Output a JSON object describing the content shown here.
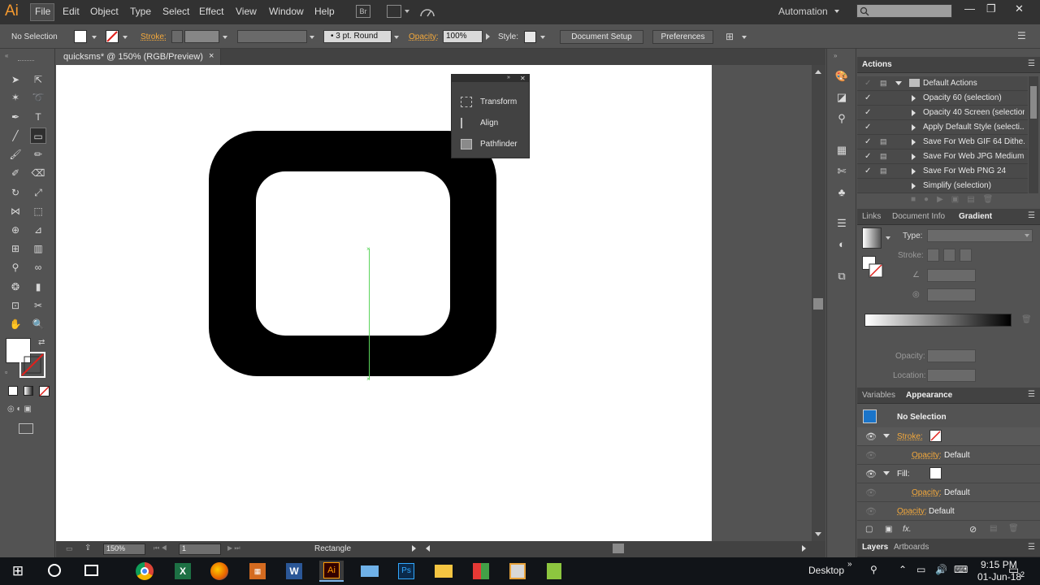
{
  "app": {
    "logo": "Ai"
  },
  "menu": [
    "File",
    "Edit",
    "Object",
    "Type",
    "Select",
    "Effect",
    "View",
    "Window",
    "Help"
  ],
  "menu_icons": {
    "bridge": "Br",
    "arrange": "arrange-documents-icon",
    "gpu": "gpu-performance-icon"
  },
  "workspace": "Automation",
  "window_buttons": {
    "minimize": "—",
    "restore": "❐",
    "close": "✕"
  },
  "control": {
    "selection": "No Selection",
    "stroke_label": "Stroke:",
    "brush": "3 pt. Round",
    "opacity_label": "Opacity:",
    "opacity_value": "100%",
    "style_label": "Style:",
    "document_setup": "Document Setup",
    "preferences": "Preferences"
  },
  "document": {
    "tab_label": "quicksms* @ 150% (RGB/Preview)",
    "close": "×"
  },
  "status": {
    "zoom": "150%",
    "artboard": "1",
    "tool": "Rectangle"
  },
  "floating_panel": {
    "items": [
      {
        "label": "Transform",
        "icon": "transform-icon"
      },
      {
        "label": "Align",
        "icon": "align-icon"
      },
      {
        "label": "Pathfinder",
        "icon": "pathfinder-icon"
      }
    ]
  },
  "actions_panel": {
    "tab": "Actions",
    "set": "Default Actions",
    "items": [
      "Opacity 60 (selection)",
      "Opacity 40 Screen (selection)",
      "Apply Default Style (selecti...",
      "Save For Web GIF 64 Dithe...",
      "Save For Web JPG Medium",
      "Save For Web PNG 24",
      "Simplify (selection)"
    ]
  },
  "gradient_panel": {
    "tabs": [
      "Links",
      "Document Info",
      "Gradient"
    ],
    "type_label": "Type:",
    "stroke_label": "Stroke:",
    "opacity_label": "Opacity:",
    "location_label": "Location:"
  },
  "appearance_panel": {
    "tabs": [
      "Variables",
      "Appearance"
    ],
    "title": "No Selection",
    "stroke_label": "Stroke:",
    "fill_label": "Fill:",
    "opacity_label": "Opacity:",
    "opacity_value": "Default",
    "fx": "fx."
  },
  "layers_panel": {
    "tabs": [
      "Layers",
      "Artboards"
    ]
  },
  "taskbar": {
    "desktop": "Desktop",
    "time": "9:15 PM",
    "date": "01-Jun-18",
    "notifications": "2"
  },
  "colors": {
    "accent": "#f4a93c",
    "guide": "#5bd45b",
    "ui_dark": "#323232",
    "ui_mid": "#535353"
  }
}
